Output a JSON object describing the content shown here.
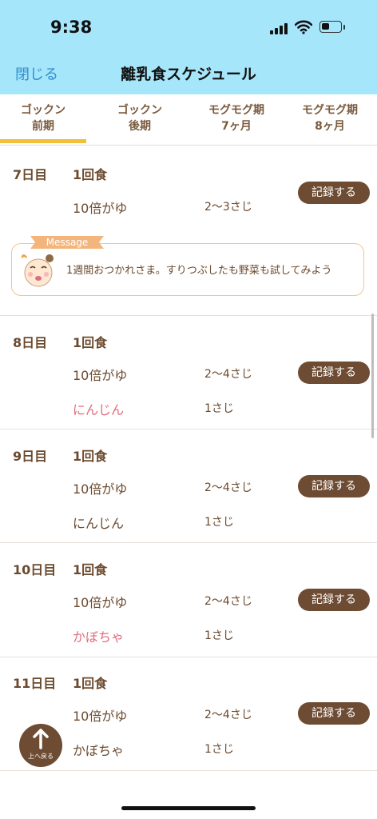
{
  "status": {
    "time": "9:38"
  },
  "header": {
    "close_label": "閉じる",
    "title": "離乳食スケジュール"
  },
  "tabs": [
    {
      "line1": "ゴックン",
      "line2": "前期",
      "selected": true
    },
    {
      "line1": "ゴックン",
      "line2": "後期",
      "selected": false
    },
    {
      "line1": "モグモグ期",
      "line2": "7ヶ月",
      "selected": false
    },
    {
      "line1": "モグモグ期",
      "line2": "8ヶ月",
      "selected": false
    }
  ],
  "colors": {
    "header_bg": "#a6e6fb",
    "accent_tab": "#f2bf3a",
    "button_brown": "#6e4c33",
    "text_brown": "#6b4a2e",
    "highlight_pink": "#e06c7d",
    "link_blue": "#2f8fcf"
  },
  "message": {
    "label": "Message",
    "text": "1週間おつかれさま。すりつぶしたも野菜も試してみよう"
  },
  "record_label": "記録する",
  "to_top_label": "上へ戻る",
  "days": [
    {
      "day": "7日目",
      "meal": "1回食",
      "foods": [
        {
          "name": "10倍がゆ",
          "amount": "2〜3さじ",
          "highlight": false
        }
      ]
    },
    {
      "day": "8日目",
      "meal": "1回食",
      "foods": [
        {
          "name": "10倍がゆ",
          "amount": "2〜4さじ",
          "highlight": false
        },
        {
          "name": "にんじん",
          "amount": "1さじ",
          "highlight": true
        }
      ]
    },
    {
      "day": "9日目",
      "meal": "1回食",
      "foods": [
        {
          "name": "10倍がゆ",
          "amount": "2〜4さじ",
          "highlight": false
        },
        {
          "name": "にんじん",
          "amount": "1さじ",
          "highlight": false
        }
      ]
    },
    {
      "day": "10日目",
      "meal": "1回食",
      "foods": [
        {
          "name": "10倍がゆ",
          "amount": "2〜4さじ",
          "highlight": false
        },
        {
          "name": "かぼちゃ",
          "amount": "1さじ",
          "highlight": true
        }
      ]
    },
    {
      "day": "11日目",
      "meal": "1回食",
      "foods": [
        {
          "name": "10倍がゆ",
          "amount": "2〜4さじ",
          "highlight": false
        },
        {
          "name": "かぼちゃ",
          "amount": "1さじ",
          "highlight": false
        }
      ]
    }
  ]
}
